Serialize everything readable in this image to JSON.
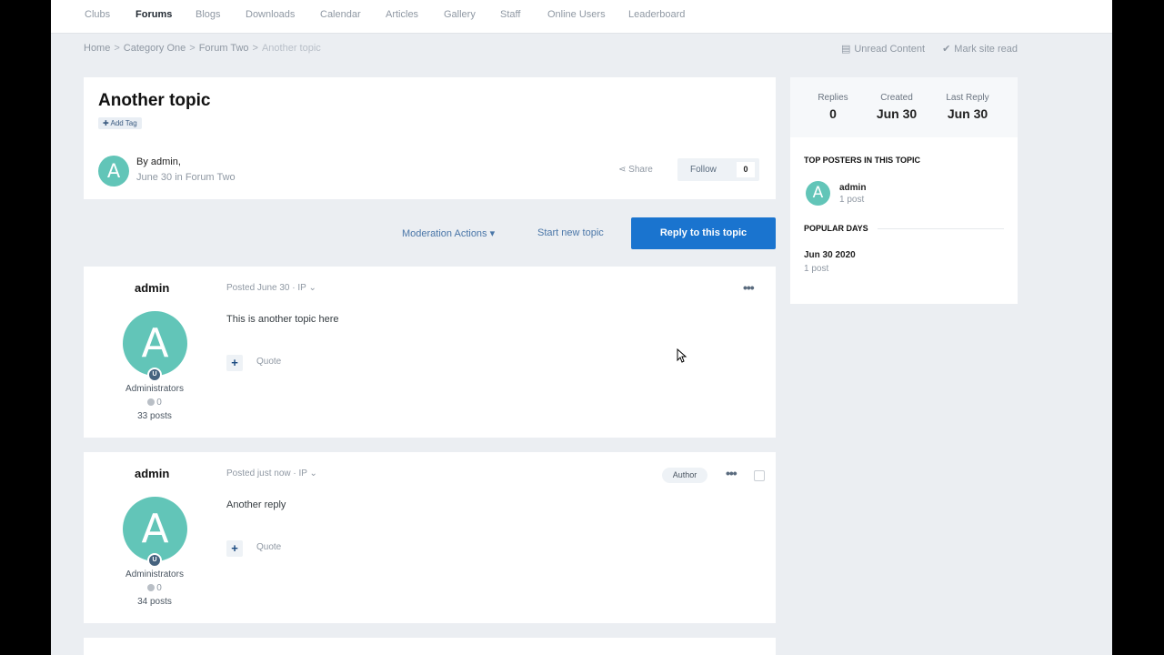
{
  "nav": [
    "Clubs",
    "Forums",
    "Blogs",
    "Downloads",
    "Calendar",
    "Articles",
    "Gallery",
    "Staff",
    "Online Users",
    "Leaderboard"
  ],
  "breadcrumb": [
    "Home",
    "Category One",
    "Forum Two",
    "Another topic"
  ],
  "crumb_actions": {
    "unread": "Unread Content",
    "mark_read": "Mark site read"
  },
  "topic": {
    "title": "Another topic",
    "add_tag": "Add Tag",
    "avatar_letter": "A",
    "by": "By admin,",
    "date_forum": "June 30 in Forum Two",
    "share": "Share",
    "follow": "Follow",
    "follow_count": "0"
  },
  "actions": {
    "moderation": "Moderation Actions",
    "start_new": "Start new topic",
    "reply": "Reply to this topic"
  },
  "posts": [
    {
      "author": "admin",
      "avatar_letter": "A",
      "group": "Administrators",
      "reputation": "0",
      "post_count": "33 posts",
      "meta": "Posted June 30 · IP",
      "body": "This is another topic here",
      "quote": "Quote"
    },
    {
      "author": "admin",
      "avatar_letter": "A",
      "group": "Administrators",
      "reputation": "0",
      "post_count": "34 posts",
      "meta": "Posted just now · IP",
      "body": "Another reply",
      "quote": "Quote",
      "badge": "Author"
    }
  ],
  "sidebar": {
    "stats": [
      {
        "label": "Replies",
        "value": "0"
      },
      {
        "label": "Created",
        "value": "Jun 30"
      },
      {
        "label": "Last Reply",
        "value": "Jun 30"
      }
    ],
    "top_posters_heading": "TOP POSTERS IN THIS TOPIC",
    "top_poster": {
      "avatar_letter": "A",
      "name": "admin",
      "posts": "1 post"
    },
    "popular_days_heading": "POPULAR DAYS",
    "popular_day": {
      "date": "Jun 30 2020",
      "posts": "1 post"
    }
  },
  "colors": {
    "accent": "#1a74cf",
    "avatar": "#62c5b8",
    "link": "#4a76a8"
  }
}
